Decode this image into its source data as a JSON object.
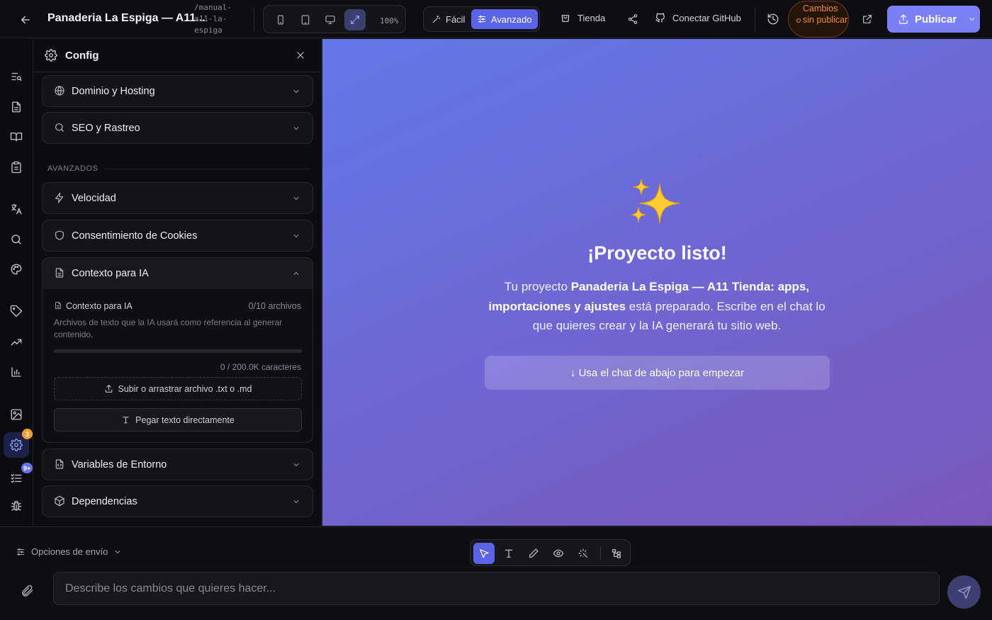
{
  "header": {
    "project_title": "Panaderia La Espiga — A11...",
    "project_slug": "/manual-a11-la-espiga",
    "zoom": "100%",
    "mode_easy": "Fácil",
    "mode_advanced": "Avanzado",
    "store": "Tienda",
    "connect_github": "Conectar GitHub",
    "unsaved": "Cambios sin publicar",
    "publish": "Publicar"
  },
  "rail": {
    "settings_badge": "3",
    "tasks_badge": "9+"
  },
  "panel": {
    "title": "Config",
    "top_items": [
      "Dominio y Hosting",
      "SEO y Rastreo"
    ],
    "section_advanced": "AVANZADOS",
    "advanced_items": [
      "Velocidad",
      "Consentimiento de Cookies"
    ],
    "context": {
      "title": "Contexto para IA",
      "row_label": "Contexto para IA",
      "count": "0/10 archivos",
      "description": "Archivos de texto que la IA usará como referencia al generar contenido.",
      "usage_fraction": 0,
      "chars": "0 / 200.0K caracteres",
      "upload": "Subir o arrastrar archivo .txt o .md",
      "paste": "Pegar texto directamente"
    },
    "bottom_items": [
      "Variables de Entorno",
      "Dependencias"
    ]
  },
  "preview": {
    "emoji": "✨",
    "title": "¡Proyecto listo!",
    "text_prefix": "Tu proyecto ",
    "project_name": "Panaderia La Espiga — A11 Tienda: apps, importaciones y ajustes",
    "text_suffix": " está preparado. Escribe en el chat lo que quieres crear y la IA generará tu sitio web.",
    "hint": "↓ Usa el chat de abajo para empezar"
  },
  "composer": {
    "send_options": "Opciones de envío",
    "placeholder": "Describe los cambios que quieres hacer..."
  },
  "colors": {
    "accent": "#5b63e8",
    "publish": "#7b7ff5",
    "warning": "#f08a3a",
    "badge_orange": "#f0a030",
    "badge_blue": "#6a6ff0"
  }
}
